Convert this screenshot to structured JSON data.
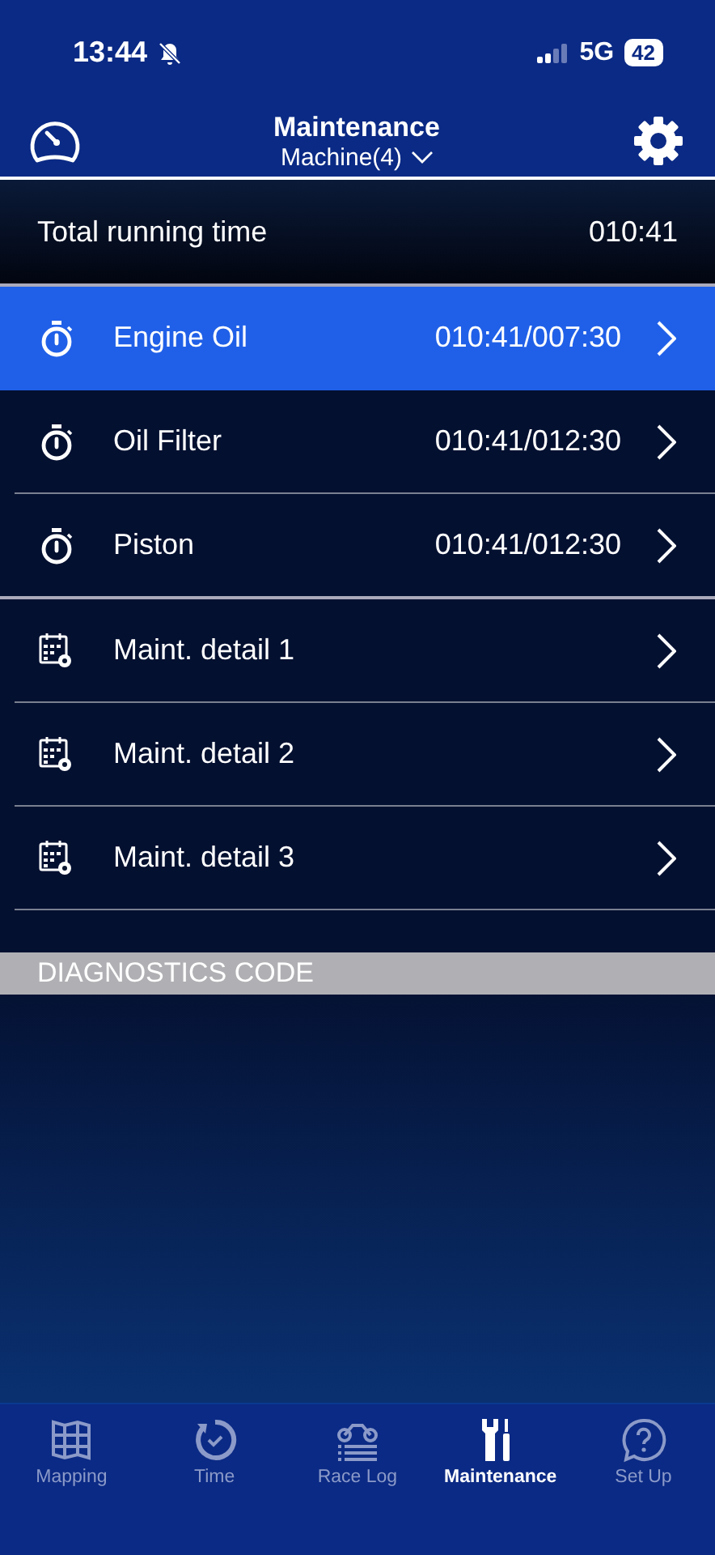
{
  "status_bar": {
    "time": "13:44",
    "network": "5G",
    "battery": "42"
  },
  "header": {
    "title": "Maintenance",
    "subtitle": "Machine(4)"
  },
  "total": {
    "label": "Total running time",
    "value": "010:41"
  },
  "items": [
    {
      "kind": "timer",
      "label": "Engine Oil",
      "value": "010:41/007:30",
      "selected": true
    },
    {
      "kind": "timer",
      "label": "Oil Filter",
      "value": "010:41/012:30",
      "selected": false
    },
    {
      "kind": "timer",
      "label": "Piston",
      "value": "010:41/012:30",
      "selected": false
    },
    {
      "kind": "detail",
      "label": "Maint. detail 1",
      "selected": false
    },
    {
      "kind": "detail",
      "label": "Maint. detail 2",
      "selected": false
    },
    {
      "kind": "detail",
      "label": "Maint. detail 3",
      "selected": false
    }
  ],
  "section": {
    "title": "DIAGNOSTICS CODE"
  },
  "tabs": [
    {
      "kind": "map",
      "label": "Mapping",
      "selected": false
    },
    {
      "kind": "time",
      "label": "Time",
      "selected": false
    },
    {
      "kind": "log",
      "label": "Race Log",
      "selected": false
    },
    {
      "kind": "tools",
      "label": "Maintenance",
      "selected": true
    },
    {
      "kind": "help",
      "label": "Set Up",
      "selected": false
    }
  ]
}
